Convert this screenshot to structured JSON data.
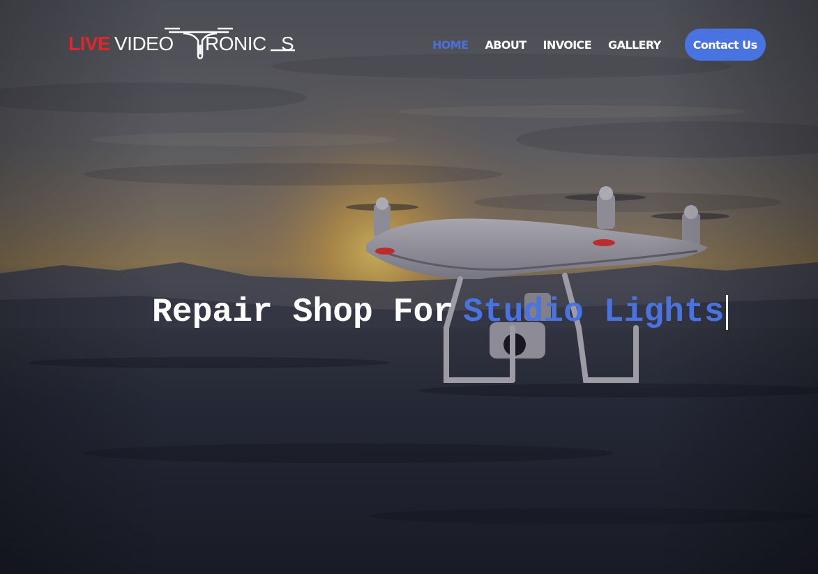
{
  "header": {
    "logo": {
      "text_red": "LIVE",
      "text_white": "VIDEO",
      "text_white_2": "RONIC",
      "text_white_3": "S",
      "icon": "drone-logo-icon"
    },
    "nav": {
      "items": [
        {
          "label": "HOME",
          "active": true
        },
        {
          "label": "ABOUT",
          "active": false
        },
        {
          "label": "INVOICE",
          "active": false
        },
        {
          "label": "GALLERY",
          "active": false
        }
      ],
      "cta_label": "Contact Us"
    }
  },
  "hero": {
    "headline_static": "Repair Shop For",
    "headline_typed": "Studio Lights",
    "background": "drone-at-sunset-photo"
  },
  "colors": {
    "accent": "#4a73e2",
    "logo_red": "#e0262a",
    "text_white": "#ffffff"
  }
}
